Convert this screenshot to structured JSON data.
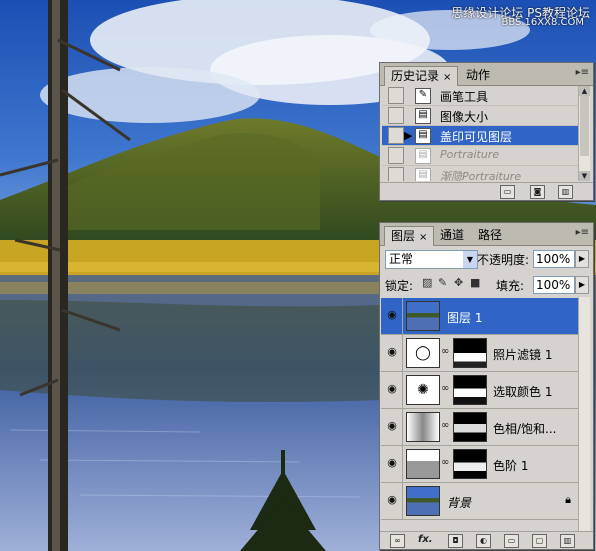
{
  "watermark": {
    "line1": "思缘设计论坛",
    "line2": "PS教程论坛",
    "line3": "BBS.16XX8.COM"
  },
  "colors": {
    "selection": "#3065c5",
    "panel_bg": "#d6d3ce"
  },
  "history_panel": {
    "tabs": [
      {
        "label": "历史记录",
        "active": true,
        "close": "×"
      },
      {
        "label": "动作",
        "active": false
      }
    ],
    "menu_icon": "panel-menu-icon",
    "items": [
      {
        "label": "画笔工具",
        "icon": "brush-icon",
        "state": "normal"
      },
      {
        "label": "图像大小",
        "icon": "image-size-icon",
        "state": "normal"
      },
      {
        "label": "盖印可见图层",
        "icon": "stamp-layer-icon",
        "state": "selected"
      },
      {
        "label": "Portraiture",
        "icon": "filter-icon",
        "state": "dimmed"
      },
      {
        "label": "渐隐Portraiture",
        "icon": "filter-icon",
        "state": "dimmed"
      }
    ],
    "footer_buttons": [
      "new-document-from-state-icon",
      "snapshot-camera-icon",
      "trash-icon"
    ]
  },
  "layers_panel": {
    "tabs": [
      {
        "label": "图层",
        "active": true,
        "close": "×"
      },
      {
        "label": "通道",
        "active": false
      },
      {
        "label": "路径",
        "active": false
      }
    ],
    "blend_mode": "正常",
    "opacity_label": "不透明度:",
    "opacity_value": "100%",
    "lock_label": "锁定:",
    "fill_label": "填充:",
    "fill_value": "100%",
    "layers": [
      {
        "name": "图层 1",
        "type": "pixel",
        "selected": true,
        "visible": true
      },
      {
        "name": "照片滤镜 1",
        "type": "adjustment",
        "thumb": "photo-filter-icon",
        "selected": false,
        "visible": true
      },
      {
        "name": "选取颜色 1",
        "type": "adjustment",
        "thumb": "selective-color-icon",
        "selected": false,
        "visible": true
      },
      {
        "name": "色相/饱和...",
        "type": "adjustment",
        "thumb": "hue-saturation-icon",
        "selected": false,
        "visible": true
      },
      {
        "name": "色阶 1",
        "type": "adjustment",
        "thumb": "levels-icon",
        "selected": false,
        "visible": true
      },
      {
        "name": "背景",
        "type": "background",
        "selected": false,
        "visible": true,
        "locked": true
      }
    ],
    "footer_buttons": [
      "link-layers-icon",
      "fx-icon",
      "add-mask-icon",
      "adjustment-layer-icon",
      "new-group-icon",
      "new-layer-icon",
      "trash-icon"
    ],
    "fx_label": "fx."
  }
}
